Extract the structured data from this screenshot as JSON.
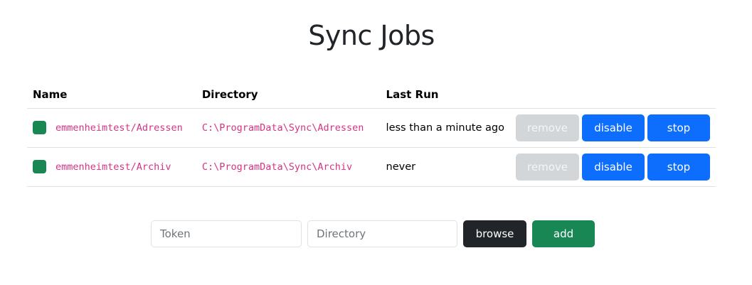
{
  "page": {
    "title": "Sync Jobs"
  },
  "table": {
    "headers": {
      "name": "Name",
      "directory": "Directory",
      "last_run": "Last Run"
    },
    "rows": [
      {
        "status_color": "#198754",
        "name": "emmenheimtest/Adressen",
        "directory": "C:\\ProgramData\\Sync\\Adressen",
        "last_run": "less than a minute ago",
        "remove_label": "remove",
        "disable_label": "disable",
        "stop_label": "stop"
      },
      {
        "status_color": "#198754",
        "name": "emmenheimtest/Archiv",
        "directory": "C:\\ProgramData\\Sync\\Archiv",
        "last_run": "never",
        "remove_label": "remove",
        "disable_label": "disable",
        "stop_label": "stop"
      }
    ]
  },
  "form": {
    "token_placeholder": "Token",
    "token_value": "",
    "directory_placeholder": "Directory",
    "directory_value": "",
    "browse_label": "browse",
    "add_label": "add"
  },
  "colors": {
    "primary": "#0d6efd",
    "success": "#198754",
    "dark": "#212529",
    "disabled": "#d3d6d9",
    "code": "#d63384"
  }
}
